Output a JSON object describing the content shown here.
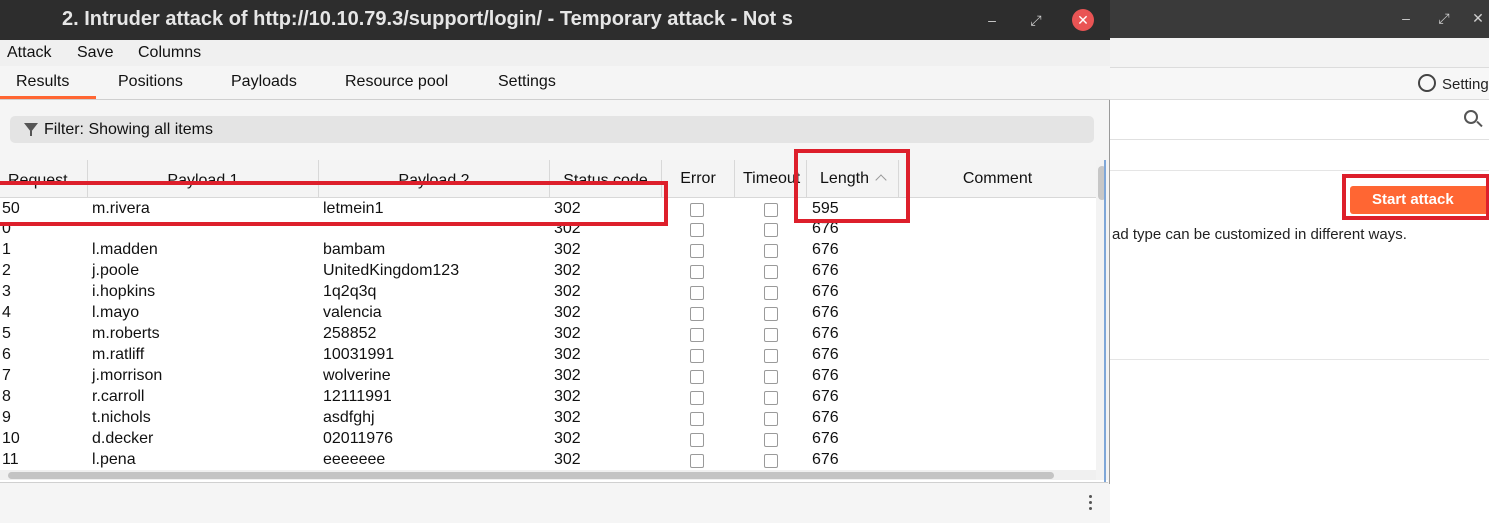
{
  "window": {
    "title": "2. Intruder attack of http://10.10.79.3/support/login/ - Temporary attack - Not s",
    "minimize": "–",
    "maximize": "⤢",
    "close": "✕"
  },
  "menu": [
    "Attack",
    "Save",
    "Columns"
  ],
  "tabs": [
    "Results",
    "Positions",
    "Payloads",
    "Resource pool",
    "Settings"
  ],
  "active_tab": "Results",
  "filter": {
    "text": "Filter: Showing all items"
  },
  "columns": [
    "Request",
    "Payload 1",
    "Payload 2",
    "Status code",
    "Error",
    "Timeout",
    "Length",
    "Comment"
  ],
  "rows": [
    {
      "request": "50",
      "payload1": "m.rivera",
      "payload2": "letmein1",
      "status": "302",
      "length": "595"
    },
    {
      "request": "0",
      "payload1": "",
      "payload2": "",
      "status": "302",
      "length": "676"
    },
    {
      "request": "1",
      "payload1": "l.madden",
      "payload2": "bambam",
      "status": "302",
      "length": "676"
    },
    {
      "request": "2",
      "payload1": "j.poole",
      "payload2": "UnitedKingdom123",
      "status": "302",
      "length": "676"
    },
    {
      "request": "3",
      "payload1": "i.hopkins",
      "payload2": "1q2q3q",
      "status": "302",
      "length": "676"
    },
    {
      "request": "4",
      "payload1": "l.mayo",
      "payload2": "valencia",
      "status": "302",
      "length": "676"
    },
    {
      "request": "5",
      "payload1": "m.roberts",
      "payload2": "258852",
      "status": "302",
      "length": "676"
    },
    {
      "request": "6",
      "payload1": "m.ratliff",
      "payload2": "10031991",
      "status": "302",
      "length": "676"
    },
    {
      "request": "7",
      "payload1": "j.morrison",
      "payload2": "wolverine",
      "status": "302",
      "length": "676"
    },
    {
      "request": "8",
      "payload1": "r.carroll",
      "payload2": "12111991",
      "status": "302",
      "length": "676"
    },
    {
      "request": "9",
      "payload1": "t.nichols",
      "payload2": "asdfghj",
      "status": "302",
      "length": "676"
    },
    {
      "request": "10",
      "payload1": "d.decker",
      "payload2": "02011976",
      "status": "302",
      "length": "676"
    },
    {
      "request": "11",
      "payload1": "l.pena",
      "payload2": "eeeeeee",
      "status": "302",
      "length": "676"
    }
  ],
  "background": {
    "settings_label": "Setting",
    "start_attack": "Start attack",
    "description": "ad type can be customized in different ways."
  },
  "colors": {
    "accent": "#ff6633",
    "highlight": "#dd1f2b",
    "titlebar": "#2d2d2d"
  }
}
